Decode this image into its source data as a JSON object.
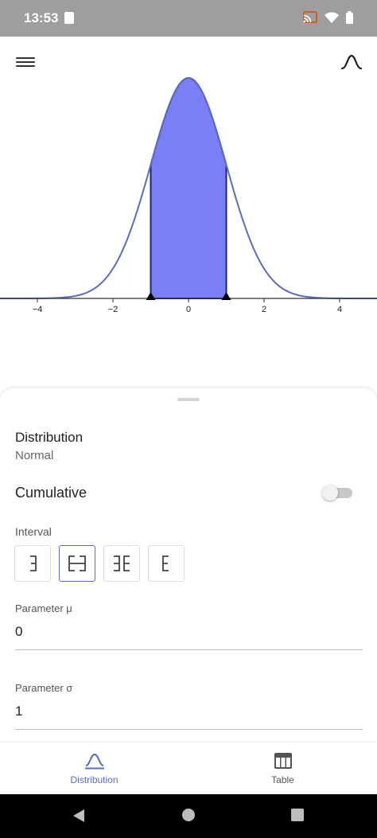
{
  "status_bar": {
    "time": "13:53"
  },
  "toolbar": {
    "menu_icon": "menu-icon",
    "distribution_icon": "bell-curve-icon"
  },
  "graph": {
    "x_ticks": [
      "−4",
      "−2",
      "0",
      "2",
      "4"
    ],
    "x_range": [
      -5,
      5
    ],
    "shaded_interval": [
      -1,
      1
    ],
    "curve_color": "#5c6bc0",
    "fill_color": "#7b7ff5",
    "outline_color": "#1a237e"
  },
  "panel": {
    "distribution_label": "Distribution",
    "distribution_value": "Normal",
    "cumulative_label": "Cumulative",
    "cumulative_on": false,
    "interval_label": "Interval",
    "interval_selected": 1,
    "param_mu_label": "Parameter μ",
    "param_mu_value": "0",
    "param_sigma_label": "Parameter σ",
    "param_sigma_value": "1"
  },
  "bottom_nav": {
    "distribution_label": "Distribution",
    "table_label": "Table",
    "active_color": "#5c6bc0",
    "inactive_color": "#555555"
  }
}
